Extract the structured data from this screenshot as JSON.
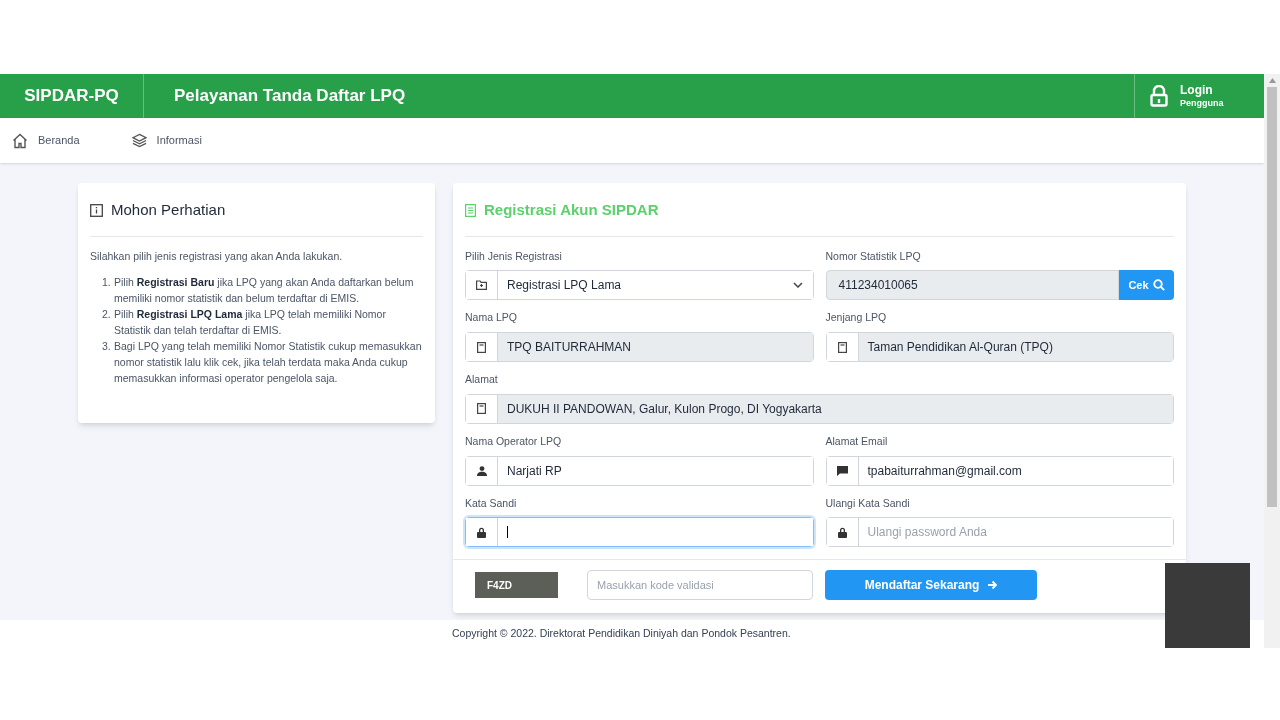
{
  "header": {
    "brand": "SIPDAR-PQ",
    "title": "Pelayanan Tanda Daftar LPQ",
    "login": {
      "label": "Login",
      "sublabel": "Pengguna"
    }
  },
  "nav": [
    {
      "label": "Beranda"
    },
    {
      "label": "Informasi"
    }
  ],
  "notice": {
    "title": "Mohon Perhatian",
    "intro": "Silahkan pilih jenis registrasi yang akan Anda lakukan.",
    "steps": [
      {
        "number": "1.",
        "text": "Pilih **Registrasi Baru** jika LPQ yang akan Anda daftarkan belum memiliki nomor statistik dan belum terdaftar di EMIS."
      },
      {
        "number": "2.",
        "text": "Pilih **Registrasi LPQ Lama** jika LPQ telah memiliki Nomor Statistik dan telah terdaftar di EMIS."
      },
      {
        "number": "3.",
        "text": "Bagi LPQ yang telah memiliki Nomor Statistik cukup memasukkan nomor statistik lalu klik cek, jika telah terdata maka Anda cukup memasukkan informasi operator pengelola saja."
      }
    ]
  },
  "form": {
    "title": "Registrasi Akun SIPDAR",
    "rows": [
      [
        {
          "label": "Pilih Jenis Registrasi",
          "kind": "select",
          "value": "Registrasi LPQ Lama",
          "readonly": false
        },
        {
          "label": "Nomor Statistik LPQ",
          "kind": "search",
          "value": "411234010065",
          "button": "Cek",
          "readonly": true
        }
      ],
      [
        {
          "label": "Nama LPQ",
          "kind": "text",
          "value": "TPQ BAITURRAHMAN",
          "readonly": true
        },
        {
          "label": "Jenjang LPQ",
          "kind": "text",
          "value": "Taman Pendidikan Al-Quran (TPQ)",
          "readonly": true
        }
      ],
      [
        {
          "label": "Alamat",
          "kind": "text",
          "value": "DUKUH II PANDOWAN, Galur, Kulon Progo, DI Yogyakarta",
          "readonly": true
        }
      ],
      [
        {
          "label": "Nama Operator LPQ",
          "kind": "text",
          "value": "Narjati RP",
          "readonly": false
        },
        {
          "label": "Alamat Email",
          "kind": "text",
          "value": "tpabaiturrahman@gmail.com",
          "readonly": false
        }
      ],
      [
        {
          "label": "Kata Sandi",
          "kind": "password",
          "focused": true,
          "readonly": false
        },
        {
          "label": "Ulangi Kata Sandi",
          "kind": "password",
          "placeholder": "Ulangi password Anda",
          "focused": false,
          "readonly": false
        }
      ]
    ],
    "captcha": "F4ZD",
    "captcha_placeholder": "Masukkan kode validasi",
    "submit": "Mendaftar Sekarang"
  },
  "footer": "Copyright © 2022. Direktorat Pendidikan Diniyah dan Pondok Pesantren."
}
